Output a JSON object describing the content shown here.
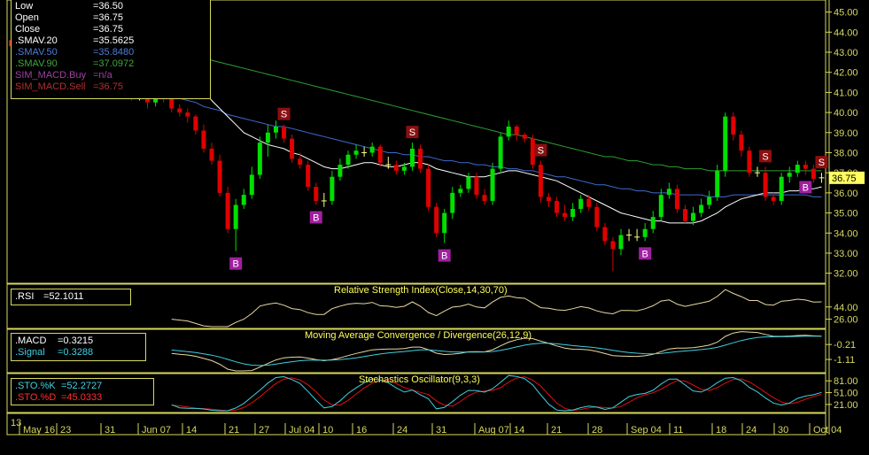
{
  "legend_main": [
    {
      "label": "Low",
      "value": "=36.50",
      "color": "#ffffff"
    },
    {
      "label": "Open",
      "value": "=36.75",
      "color": "#ffffff"
    },
    {
      "label": "Close",
      "value": "=36.75",
      "color": "#ffffff"
    },
    {
      "label": ".SMAV.20",
      "value": "=35.5625",
      "color": "#ffffff"
    },
    {
      "label": ".SMAV.50",
      "value": "=35.8480",
      "color": "#4f7dd8"
    },
    {
      "label": ".SMAV.90",
      "value": "=37.0972",
      "color": "#3fa83f"
    },
    {
      "label": "SIM_MACD.Buy",
      "value": "=n/a",
      "color": "#a040a0"
    },
    {
      "label": "SIM_MACD.Sell",
      "value": "=36.75",
      "color": "#b03030"
    }
  ],
  "price_last": "36.75",
  "price_ticks": [
    "45.00",
    "44.00",
    "43.00",
    "42.00",
    "41.00",
    "40.00",
    "39.00",
    "38.00",
    "37.00",
    "36.00",
    "35.00",
    "34.00",
    "33.00",
    "32.00"
  ],
  "rsi": {
    "title": "Relative Strength Index(Close,14,30,70)",
    "label": ".RSI",
    "value": "=52.1011",
    "ticks": [
      "44.00",
      "26.00"
    ]
  },
  "macd": {
    "title": "Moving Average Convergence / Divergence(26,12,9)",
    "labels": [
      ".MACD",
      ".Signal"
    ],
    "values": [
      "=0.3215",
      "=0.3288"
    ],
    "ticks": [
      "-0.21",
      "-1.11"
    ]
  },
  "sto": {
    "title": "Stochastics Oscillator(9,3,3)",
    "labels": [
      ".STO.%K",
      ".STO.%D"
    ],
    "values": [
      "=52.2727",
      "=45.0333"
    ],
    "ticks": [
      "81.00",
      "51.00",
      "21.00"
    ]
  },
  "x_axis": {
    "year": "13",
    "ticks": [
      "May 16",
      "23",
      "31",
      "Jun 07",
      "14",
      "21",
      "27",
      "Jul 04",
      "10",
      "16",
      "24",
      "31",
      "Aug 07",
      "14",
      "21",
      "28",
      "Sep 04",
      "11",
      "18",
      "24",
      "30",
      "Oct 04"
    ]
  },
  "colors": {
    "up": "#00e000",
    "down": "#e00000",
    "sma20": "#ffffff",
    "sma50": "#3d6bd0",
    "sma90": "#2fa02f",
    "grid": "#d8d860",
    "rsi": "#e8d8a0",
    "macd": "#e8d8a0",
    "signal": "#40d0e0",
    "stoK": "#40d0e0",
    "stoD": "#e01010",
    "buy": "#a020a0",
    "sell": "#8b1010"
  },
  "chart_data": {
    "type": "candlestick",
    "x": [
      "May 13",
      "May 14",
      "May 15",
      "May 16",
      "May 17",
      "May 20",
      "May 21",
      "May 22",
      "May 23",
      "May 24",
      "May 28",
      "May 29",
      "May 30",
      "May 31",
      "Jun 03",
      "Jun 04",
      "Jun 05",
      "Jun 06",
      "Jun 07",
      "Jun 10",
      "Jun 11",
      "Jun 12",
      "Jun 13",
      "Jun 14",
      "Jun 17",
      "Jun 18",
      "Jun 19",
      "Jun 20",
      "Jun 21",
      "Jun 24",
      "Jun 25",
      "Jun 26",
      "Jun 27",
      "Jun 28",
      "Jul 01",
      "Jul 02",
      "Jul 03",
      "Jul 05",
      "Jul 08",
      "Jul 09",
      "Jul 10",
      "Jul 11",
      "Jul 12",
      "Jul 15",
      "Jul 16",
      "Jul 17",
      "Jul 18",
      "Jul 19",
      "Jul 22",
      "Jul 23",
      "Jul 24",
      "Jul 25",
      "Jul 26",
      "Jul 29",
      "Jul 30",
      "Jul 31",
      "Aug 01",
      "Aug 02",
      "Aug 05",
      "Aug 06",
      "Aug 07",
      "Aug 08",
      "Aug 09",
      "Aug 12",
      "Aug 13",
      "Aug 14",
      "Aug 15",
      "Aug 16",
      "Aug 19",
      "Aug 20",
      "Aug 21",
      "Aug 22",
      "Aug 23",
      "Aug 26",
      "Aug 27",
      "Aug 28",
      "Aug 29",
      "Aug 30",
      "Sep 03",
      "Sep 04",
      "Sep 05",
      "Sep 06",
      "Sep 09",
      "Sep 10",
      "Sep 11",
      "Sep 12",
      "Sep 13",
      "Sep 16",
      "Sep 17",
      "Sep 18",
      "Sep 19",
      "Sep 20",
      "Sep 23",
      "Sep 24",
      "Sep 25",
      "Sep 26",
      "Sep 27",
      "Sep 30",
      "Oct 01",
      "Oct 02",
      "Oct 03",
      "Oct 04"
    ],
    "open": [
      43.6,
      43.3,
      43.2,
      43.3,
      43.5,
      43.4,
      43.8,
      44.0,
      43.8,
      43.6,
      43.0,
      42.6,
      42.2,
      41.6,
      41.0,
      41.2,
      40.8,
      40.9,
      40.5,
      41.2,
      40.7,
      40.2,
      40.0,
      39.8,
      39.1,
      38.2,
      37.6,
      36.0,
      34.2,
      35.4,
      35.9,
      36.9,
      38.5,
      39.0,
      39.3,
      38.7,
      37.7,
      37.4,
      36.3,
      35.6,
      35.6,
      36.8,
      37.4,
      37.9,
      38.1,
      38.0,
      38.3,
      37.5,
      37.4,
      37.1,
      37.3,
      38.2,
      37.2,
      35.3,
      34.0,
      35.0,
      36.0,
      36.2,
      36.8,
      35.9,
      35.6,
      37.2,
      38.8,
      39.3,
      38.9,
      38.7,
      37.4,
      35.8,
      35.6,
      35.0,
      34.8,
      35.2,
      35.7,
      35.3,
      34.3,
      33.6,
      33.2,
      33.9,
      33.9,
      33.8,
      34.2,
      34.8,
      35.9,
      36.2,
      35.2,
      34.6,
      35.0,
      35.4,
      35.8,
      37.1,
      39.8,
      38.9,
      38.1,
      37.0,
      37.0,
      35.8,
      35.6,
      36.8,
      37.0,
      37.4,
      37.2,
      36.7
    ],
    "close": [
      43.3,
      43.2,
      43.3,
      43.5,
      43.4,
      43.8,
      44.0,
      43.8,
      43.6,
      43.0,
      42.6,
      42.2,
      41.6,
      41.0,
      41.2,
      40.8,
      40.9,
      40.5,
      41.2,
      40.7,
      40.2,
      40.0,
      39.8,
      39.1,
      38.2,
      37.6,
      36.0,
      34.2,
      35.4,
      35.9,
      36.9,
      38.5,
      39.0,
      39.3,
      38.7,
      37.7,
      37.4,
      36.3,
      35.6,
      35.6,
      36.8,
      37.4,
      37.9,
      38.1,
      38.0,
      38.3,
      37.5,
      37.4,
      37.1,
      37.3,
      38.2,
      37.2,
      35.3,
      34.0,
      35.0,
      36.0,
      36.2,
      36.8,
      35.9,
      35.6,
      37.2,
      38.8,
      39.3,
      38.9,
      38.7,
      37.4,
      35.8,
      35.6,
      35.0,
      34.8,
      35.2,
      35.7,
      35.3,
      34.3,
      33.6,
      33.2,
      33.9,
      33.9,
      33.8,
      34.2,
      34.8,
      35.9,
      36.2,
      35.2,
      34.6,
      35.0,
      35.4,
      35.8,
      37.1,
      39.8,
      38.9,
      38.1,
      37.0,
      37.0,
      35.8,
      35.6,
      36.8,
      37.0,
      37.4,
      37.2,
      36.7,
      36.75
    ],
    "high": [
      43.9,
      43.6,
      43.5,
      43.8,
      43.8,
      44.0,
      44.3,
      44.2,
      44.0,
      43.8,
      43.2,
      42.8,
      42.4,
      41.8,
      41.5,
      41.4,
      41.1,
      41.0,
      41.5,
      41.3,
      40.9,
      40.4,
      40.2,
      39.9,
      39.4,
      38.5,
      37.9,
      36.3,
      35.7,
      36.2,
      37.3,
      38.8,
      39.4,
      39.6,
      39.4,
      38.9,
      38.0,
      37.6,
      36.5,
      36.0,
      37.1,
      37.7,
      38.1,
      38.4,
      38.3,
      38.5,
      38.4,
      37.8,
      37.6,
      37.5,
      38.5,
      38.4,
      37.4,
      35.5,
      35.2,
      36.3,
      36.4,
      37.0,
      37.0,
      36.2,
      37.5,
      39.0,
      39.6,
      39.4,
      39.0,
      38.9,
      37.6,
      36.0,
      35.8,
      35.4,
      35.5,
      35.9,
      35.9,
      35.5,
      34.5,
      33.8,
      34.2,
      34.2,
      34.2,
      34.5,
      35.1,
      36.2,
      36.5,
      36.4,
      35.4,
      35.3,
      35.7,
      36.1,
      37.4,
      40.0,
      40.0,
      39.1,
      38.3,
      37.3,
      37.3,
      36.0,
      37.0,
      37.3,
      37.6,
      37.6,
      37.4,
      37.0
    ],
    "low": [
      43.1,
      43.0,
      43.0,
      43.1,
      43.2,
      43.2,
      43.6,
      43.5,
      43.4,
      42.8,
      42.4,
      42.0,
      41.4,
      40.8,
      40.8,
      40.6,
      40.6,
      40.2,
      40.3,
      40.5,
      40.0,
      39.8,
      39.5,
      38.9,
      38.0,
      37.4,
      35.8,
      34.0,
      33.1,
      35.2,
      35.7,
      36.7,
      37.8,
      38.7,
      38.5,
      37.5,
      37.2,
      36.1,
      35.4,
      35.3,
      35.4,
      36.6,
      37.2,
      37.7,
      37.8,
      37.8,
      37.3,
      37.2,
      36.9,
      36.9,
      37.1,
      37.0,
      35.1,
      33.8,
      33.5,
      34.7,
      35.8,
      36.0,
      35.7,
      35.4,
      35.4,
      37.0,
      38.6,
      38.6,
      38.5,
      37.2,
      35.5,
      35.3,
      34.8,
      34.6,
      34.6,
      35.0,
      35.1,
      34.1,
      33.4,
      32.1,
      32.9,
      33.6,
      33.6,
      33.6,
      34.0,
      34.6,
      35.7,
      35.0,
      34.5,
      34.4,
      34.8,
      35.2,
      35.6,
      36.8,
      38.6,
      37.8,
      36.8,
      36.8,
      35.6,
      35.4,
      35.4,
      36.5,
      36.8,
      36.9,
      36.5,
      36.5
    ],
    "sma20": [
      null,
      null,
      null,
      null,
      null,
      null,
      null,
      null,
      null,
      null,
      null,
      null,
      null,
      null,
      null,
      null,
      null,
      null,
      null,
      42.3,
      42.1,
      41.9,
      41.7,
      41.4,
      41.1,
      40.6,
      40.2,
      39.8,
      39.4,
      39.0,
      38.8,
      38.6,
      38.4,
      38.3,
      38.2,
      38.0,
      37.9,
      37.7,
      37.5,
      37.3,
      37.2,
      37.2,
      37.3,
      37.4,
      37.5,
      37.5,
      37.4,
      37.3,
      37.3,
      37.4,
      37.5,
      37.5,
      37.4,
      37.2,
      37.1,
      37.0,
      36.9,
      36.8,
      36.8,
      36.8,
      36.9,
      37.0,
      37.1,
      37.1,
      37.0,
      36.9,
      36.8,
      36.7,
      36.6,
      36.4,
      36.2,
      36.0,
      35.8,
      35.6,
      35.4,
      35.2,
      35.0,
      34.9,
      34.8,
      34.7,
      34.6,
      34.6,
      34.5,
      34.5,
      34.5,
      34.5,
      34.6,
      34.8,
      35.0,
      35.3,
      35.5,
      35.7,
      35.8,
      35.9,
      36.0,
      36.0,
      36.0,
      36.1,
      36.1,
      36.2,
      36.2,
      36.3
    ],
    "sma50": [
      43.2,
      43.1,
      43.0,
      42.9,
      42.9,
      42.8,
      42.7,
      42.7,
      42.6,
      42.5,
      42.4,
      42.2,
      42.1,
      41.9,
      41.8,
      41.6,
      41.5,
      41.3,
      41.2,
      41.0,
      40.9,
      40.7,
      40.6,
      40.5,
      40.3,
      40.2,
      40.1,
      39.9,
      39.8,
      39.7,
      39.6,
      39.5,
      39.4,
      39.3,
      39.3,
      39.2,
      39.1,
      39.0,
      38.9,
      38.8,
      38.7,
      38.6,
      38.5,
      38.4,
      38.3,
      38.2,
      38.1,
      38.0,
      38.0,
      37.9,
      37.9,
      37.8,
      37.8,
      37.7,
      37.6,
      37.6,
      37.5,
      37.5,
      37.4,
      37.4,
      37.3,
      37.3,
      37.2,
      37.2,
      37.1,
      37.1,
      37.0,
      36.9,
      36.8,
      36.8,
      36.7,
      36.6,
      36.5,
      36.4,
      36.4,
      36.3,
      36.2,
      36.2,
      36.1,
      36.1,
      36.0,
      36.0,
      36.0,
      35.9,
      35.9,
      35.9,
      35.9,
      35.8,
      35.8,
      35.8,
      35.9,
      35.9,
      35.9,
      35.9,
      35.9,
      35.9,
      35.9,
      35.9,
      35.9,
      35.9,
      35.8,
      35.8
    ],
    "sma90": [
      44.6,
      44.5,
      44.5,
      44.4,
      44.4,
      44.3,
      44.3,
      44.2,
      44.2,
      44.1,
      44.0,
      44.0,
      43.9,
      43.8,
      43.8,
      43.7,
      43.6,
      43.5,
      43.4,
      43.3,
      43.2,
      43.1,
      43.0,
      42.9,
      42.8,
      42.6,
      42.5,
      42.4,
      42.3,
      42.2,
      42.1,
      42.0,
      41.9,
      41.8,
      41.7,
      41.6,
      41.5,
      41.4,
      41.3,
      41.2,
      41.1,
      41.0,
      40.9,
      40.8,
      40.7,
      40.6,
      40.5,
      40.4,
      40.3,
      40.2,
      40.1,
      40.0,
      39.9,
      39.8,
      39.7,
      39.6,
      39.5,
      39.4,
      39.3,
      39.2,
      39.1,
      39.0,
      38.9,
      38.9,
      38.8,
      38.7,
      38.6,
      38.5,
      38.4,
      38.3,
      38.2,
      38.1,
      38.0,
      37.9,
      37.8,
      37.8,
      37.7,
      37.6,
      37.6,
      37.5,
      37.4,
      37.4,
      37.3,
      37.3,
      37.2,
      37.2,
      37.2,
      37.1,
      37.1,
      37.1,
      37.1,
      37.1,
      37.1,
      37.1,
      37.1,
      37.1,
      37.1,
      37.1,
      37.1,
      37.1,
      37.1,
      37.1
    ],
    "buy_signals": [
      {
        "i": 28,
        "label": "B"
      },
      {
        "i": 38,
        "label": "B"
      },
      {
        "i": 54,
        "label": "B"
      },
      {
        "i": 79,
        "label": "B"
      },
      {
        "i": 99,
        "label": "B"
      }
    ],
    "sell_signals": [
      {
        "i": 34,
        "label": "S"
      },
      {
        "i": 50,
        "label": "S"
      },
      {
        "i": 66,
        "label": "S"
      },
      {
        "i": 94,
        "label": "S"
      },
      {
        "i": 101,
        "label": "S"
      }
    ],
    "ylim": [
      31.5,
      45.6
    ],
    "rsi_ylim": [
      15,
      75
    ],
    "macd_ylim": [
      -1.8,
      0.6
    ],
    "sto_ylim": [
      5,
      95
    ]
  }
}
